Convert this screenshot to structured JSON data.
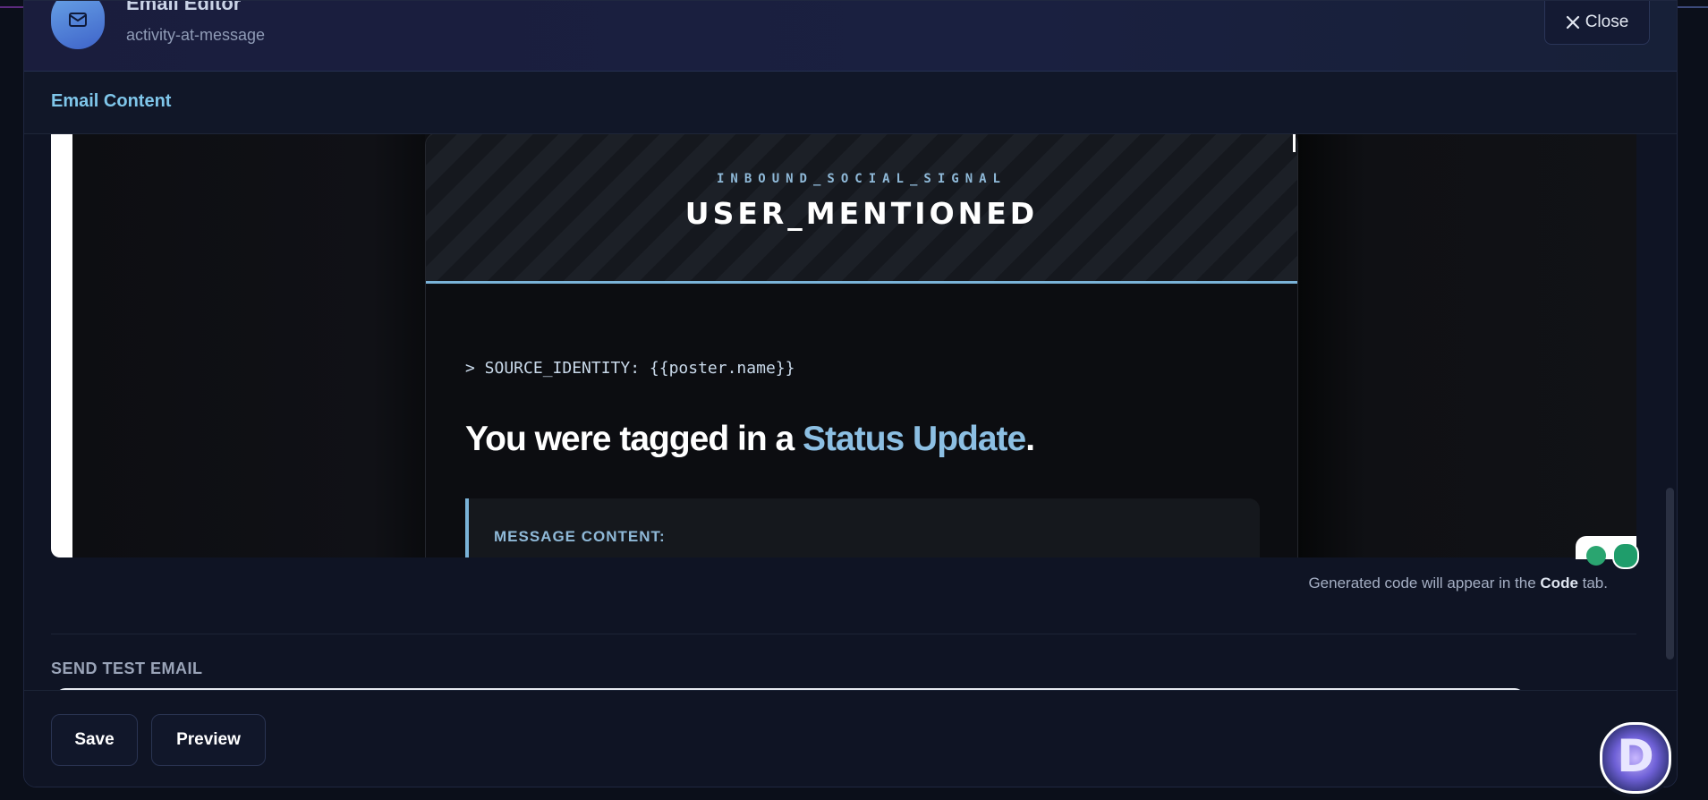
{
  "header": {
    "title": "Email Editor",
    "subtitle": "activity-at-message",
    "icon": "mail-icon",
    "close_label": "Close"
  },
  "tabs": {
    "active_label": "Email Content"
  },
  "preview": {
    "signal": "INBOUND_SOCIAL_SIGNAL",
    "event": "USER_MENTIONED",
    "source_line": "> SOURCE_IDENTITY: {{poster.name}}",
    "headline_prefix": "You were tagged in a ",
    "headline_highlight": "Status Update",
    "headline_suffix": ".",
    "message_label": "MESSAGE CONTENT:",
    "colors": {
      "accent": "#7ab3d8",
      "headline_highlight": "#8cbfe3"
    }
  },
  "hint": {
    "prefix": "Generated code will appear in the ",
    "bold": "Code",
    "suffix": " tab."
  },
  "send_test": {
    "label": "SEND TEST EMAIL"
  },
  "footer": {
    "save_label": "Save",
    "preview_label": "Preview"
  },
  "assistant": {
    "letter": "D",
    "icon": "assistant-avatar-icon"
  }
}
